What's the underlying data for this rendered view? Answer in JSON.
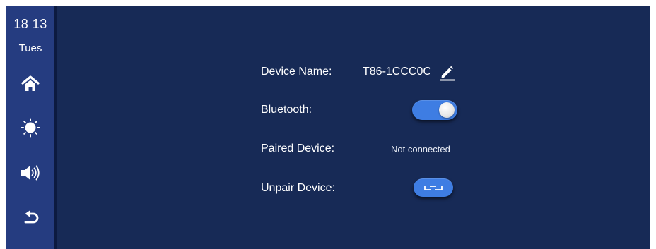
{
  "status": {
    "time": "18 13",
    "day": "Tues"
  },
  "sidebar": {
    "items": [
      {
        "name": "home",
        "icon": "home-icon"
      },
      {
        "name": "brightness",
        "icon": "sun-icon"
      },
      {
        "name": "volume",
        "icon": "speaker-icon"
      },
      {
        "name": "back",
        "icon": "back-arrow-icon"
      }
    ]
  },
  "settings": {
    "device_name_label": "Device Name:",
    "device_name_value": "T86-1CCC0C",
    "bluetooth_label": "Bluetooth:",
    "bluetooth_on": true,
    "paired_label": "Paired Device:",
    "paired_value": "Not connected",
    "unpair_label": "Unpair Device:"
  },
  "colors": {
    "background": "#172a56",
    "sidebar": "#253c80",
    "accent": "#3e7de3",
    "text": "#ffffff"
  }
}
